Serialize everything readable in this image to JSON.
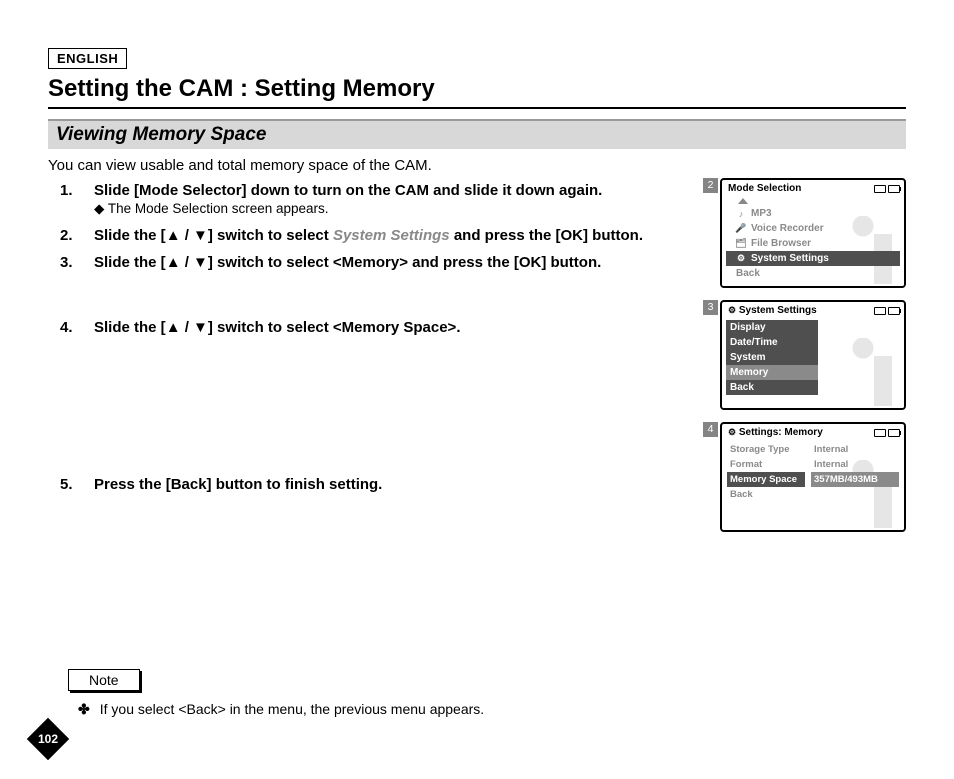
{
  "language_badge": "ENGLISH",
  "page_title": "Setting the CAM : Setting Memory",
  "section_heading": "Viewing Memory Space",
  "intro": "You can view usable and total memory space of the CAM.",
  "steps": [
    {
      "num": "1.",
      "main": "Slide [Mode Selector] down to turn on the CAM and slide it down again.",
      "sub": "◆ The Mode Selection screen appears."
    },
    {
      "num": "2.",
      "main_pre": "Slide the [",
      "main_mid": "] switch to select ",
      "main_gray": "System Settings",
      "main_post": " and press the [OK] button."
    },
    {
      "num": "3.",
      "main_pre": "Slide the [",
      "main_post": "] switch to select <Memory> and press the [OK] button."
    },
    {
      "num": "4.",
      "main_pre": "Slide the [",
      "main_post": "] switch to select <Memory Space>."
    },
    {
      "num": "5.",
      "main": "Press the [Back] button to finish setting."
    }
  ],
  "arrows": "▲ / ▼",
  "note_label": "Note",
  "note_item": "If you select <Back> in the menu, the previous menu appears.",
  "page_number": "102",
  "screens": {
    "s2": {
      "tag": "2",
      "title": "Mode Selection",
      "rows": [
        {
          "icon": "♪",
          "label": "MP3"
        },
        {
          "icon": "🎤",
          "label": "Voice Recorder"
        },
        {
          "icon": "🗂",
          "label": "File Browser"
        },
        {
          "icon": "⚙",
          "label": "System Settings",
          "selected": true
        }
      ],
      "back": "Back"
    },
    "s3": {
      "tag": "3",
      "title_icon": "⚙",
      "title": "System Settings",
      "rows": [
        {
          "label": "Display",
          "style": "dark"
        },
        {
          "label": "Date/Time",
          "style": "dark"
        },
        {
          "label": "System",
          "style": "dark"
        },
        {
          "label": "Memory",
          "style": "mid"
        },
        {
          "label": "Back",
          "style": "dark"
        }
      ]
    },
    "s4": {
      "tag": "4",
      "title_icon": "⚙",
      "title": "Settings: Memory",
      "rows": [
        {
          "k": "Storage Type",
          "v": "Internal"
        },
        {
          "k": "Format",
          "v": "Internal"
        },
        {
          "k": "Memory Space",
          "v": "357MB/493MB",
          "selected": true
        }
      ],
      "back": "Back"
    }
  }
}
